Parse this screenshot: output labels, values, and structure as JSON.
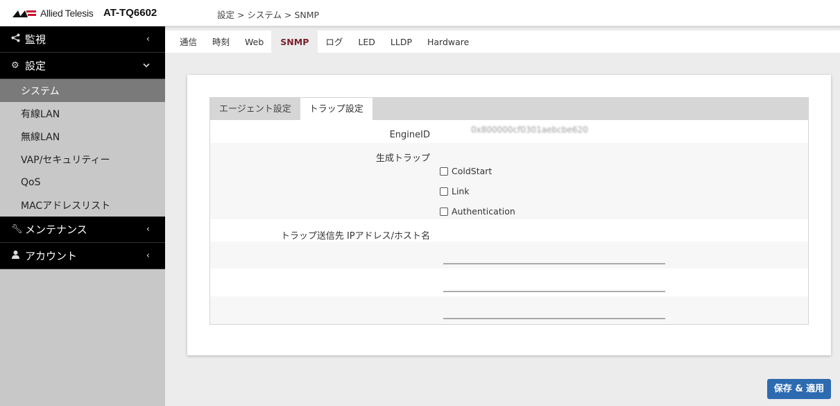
{
  "header": {
    "brand": "Allied Telesis",
    "model": "AT-TQ6602",
    "breadcrumb": "設定 > システム > SNMP"
  },
  "sidebar": {
    "sections": [
      {
        "label": "監視",
        "icon": "share-icon",
        "chevron": "<"
      },
      {
        "label": "設定",
        "icon": "gear-icon",
        "chevron": "⌄"
      },
      {
        "label": "メンテナンス",
        "icon": "wrench-icon",
        "chevron": "<"
      },
      {
        "label": "アカウント",
        "icon": "user-icon",
        "chevron": "<"
      }
    ],
    "settings_items": [
      "システム",
      "有線LAN",
      "無線LAN",
      "VAP/セキュリティー",
      "QoS",
      "MACアドレスリスト"
    ],
    "active_item": "システム"
  },
  "tabs": [
    "通信",
    "時刻",
    "Web",
    "SNMP",
    "ログ",
    "LED",
    "LLDP",
    "Hardware"
  ],
  "active_tab": "SNMP",
  "subtabs": [
    "エージェント設定",
    "トラップ設定"
  ],
  "active_subtab": "トラップ設定",
  "form": {
    "engine_id_label": "EngineID",
    "engine_id_value": "0x800000cf0301aebcbe620",
    "traps_label": "生成トラップ",
    "traps": [
      {
        "label": "ColdStart",
        "checked": false
      },
      {
        "label": "Link",
        "checked": false
      },
      {
        "label": "Authentication",
        "checked": false
      }
    ],
    "dest_label": "トラップ送信先 IPアドレス/ホスト名",
    "dest_values": [
      "",
      "",
      ""
    ]
  },
  "save_button": "保存 & 適用",
  "colors": {
    "accent": "#2d6bb1",
    "active_tab": "#7a1f2a",
    "sidebar_header": "#000000"
  }
}
